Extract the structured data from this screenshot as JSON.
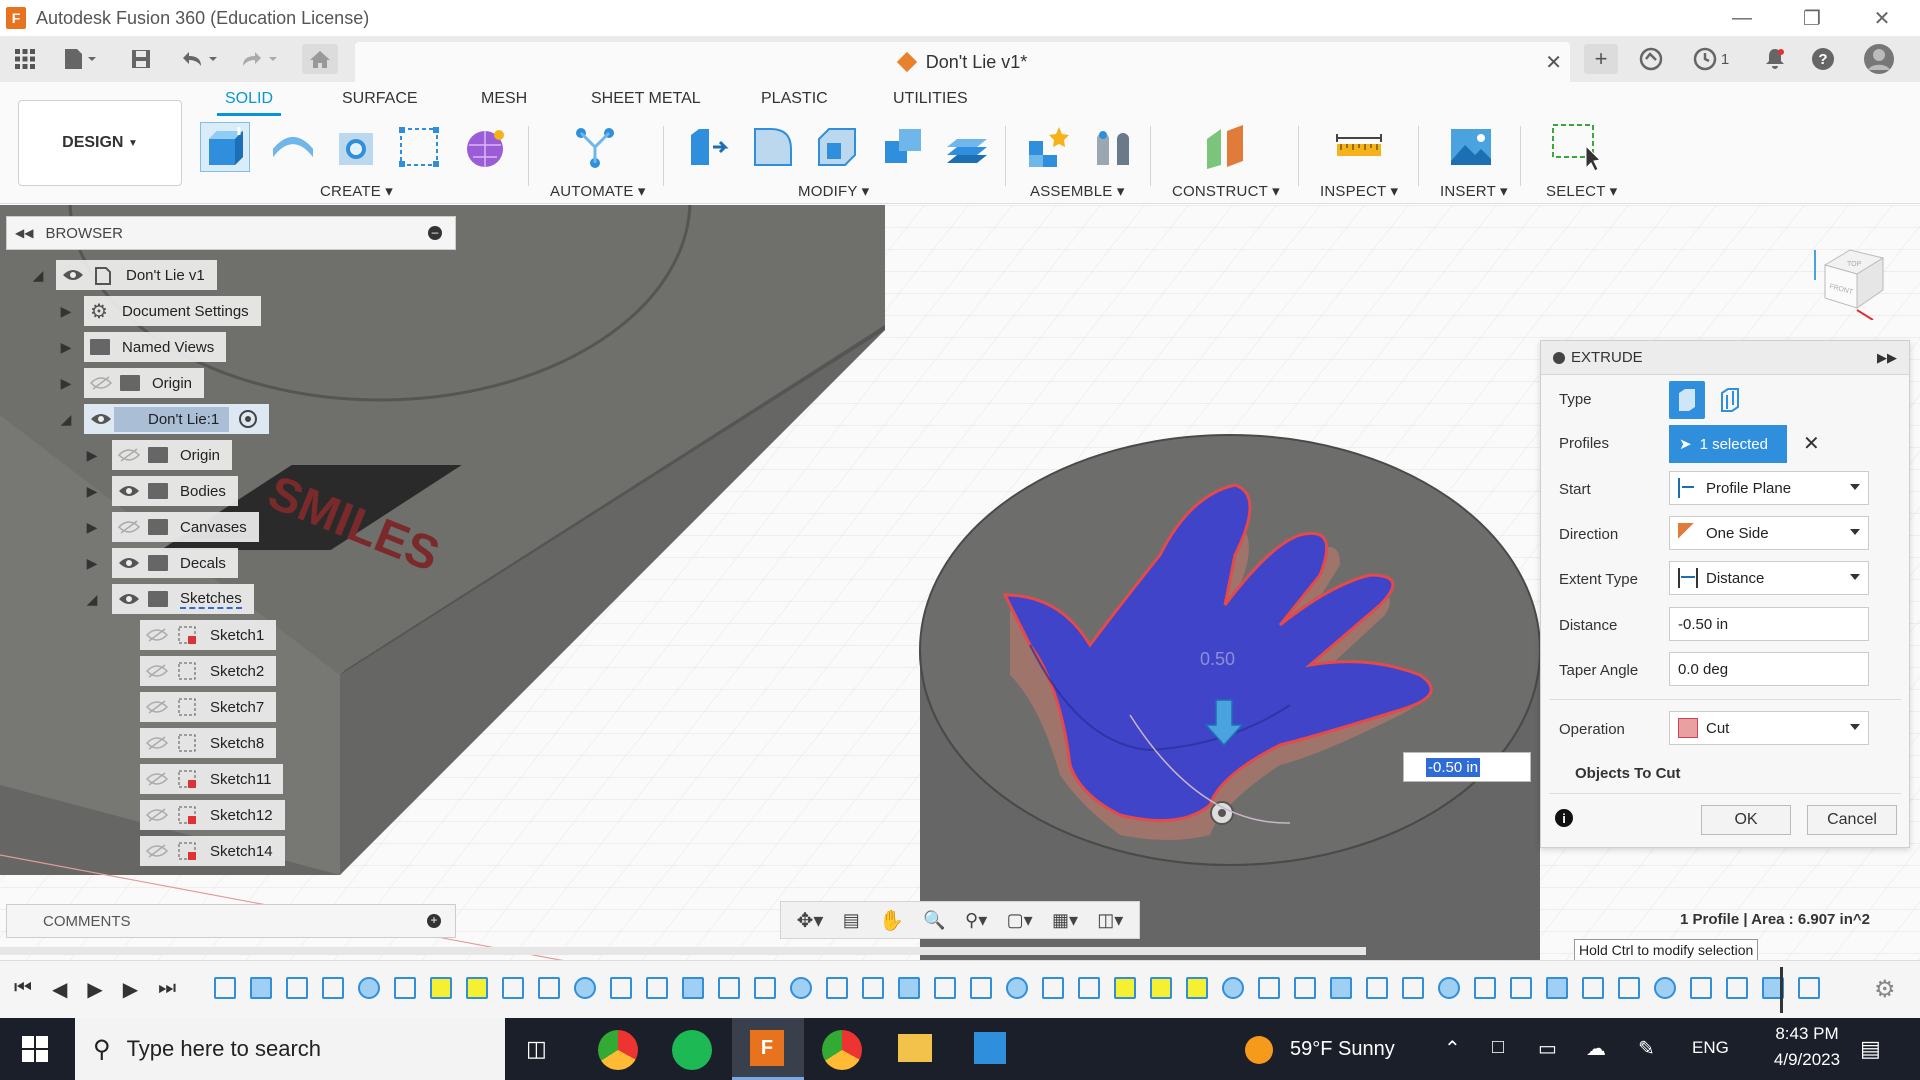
{
  "window": {
    "title": "Autodesk Fusion 360 (Education License)"
  },
  "document": {
    "tab_name": "Don't Lie v1*",
    "jobs_count": "1"
  },
  "workspace": {
    "label": "DESIGN"
  },
  "ribbon": {
    "tabs": [
      "SOLID",
      "SURFACE",
      "MESH",
      "SHEET METAL",
      "PLASTIC",
      "UTILITIES"
    ],
    "groups": [
      "CREATE",
      "AUTOMATE",
      "MODIFY",
      "ASSEMBLE",
      "CONSTRUCT",
      "INSPECT",
      "INSERT",
      "SELECT"
    ]
  },
  "browser": {
    "header": "BROWSER",
    "root": "Don't Lie v1",
    "items": {
      "doc_settings": "Document Settings",
      "named_views": "Named Views",
      "origin_top": "Origin",
      "component": "Don't Lie:1",
      "origin": "Origin",
      "bodies": "Bodies",
      "canvases": "Canvases",
      "decals": "Decals",
      "sketches": "Sketches"
    },
    "sketches": [
      "Sketch1",
      "Sketch2",
      "Sketch7",
      "Sketch8",
      "Sketch11",
      "Sketch12",
      "Sketch14"
    ]
  },
  "comments": {
    "header": "COMMENTS"
  },
  "viewcube": {
    "top": "TOP",
    "front": "FRONT"
  },
  "model": {
    "decal_text": "SMILES",
    "dimension_value": "0.50",
    "input_value": "-0.50 in"
  },
  "extrude": {
    "title": "EXTRUDE",
    "labels": {
      "type": "Type",
      "profiles": "Profiles",
      "start": "Start",
      "direction": "Direction",
      "extent_type": "Extent Type",
      "distance": "Distance",
      "taper": "Taper Angle",
      "operation": "Operation",
      "objects_to_cut": "Objects To Cut"
    },
    "values": {
      "profiles_selected": "1 selected",
      "start": "Profile Plane",
      "direction": "One Side",
      "extent_type": "Distance",
      "distance": "-0.50 in",
      "taper": "0.0 deg",
      "operation": "Cut"
    },
    "ok": "OK",
    "cancel": "Cancel"
  },
  "status": {
    "measure": "1 Profile | Area : 6.907 in^2",
    "hint": "Hold Ctrl to modify selection"
  },
  "taskbar": {
    "search_placeholder": "Type here to search",
    "weather": "59°F  Sunny",
    "language": "ENG",
    "time": "8:43 PM",
    "date": "4/9/2023"
  },
  "colors": {
    "accent": "#0696d7",
    "selection_blue": "#3a4ad8",
    "body_gray": "#6c6c6a",
    "taskbar": "#1b1f2a"
  }
}
